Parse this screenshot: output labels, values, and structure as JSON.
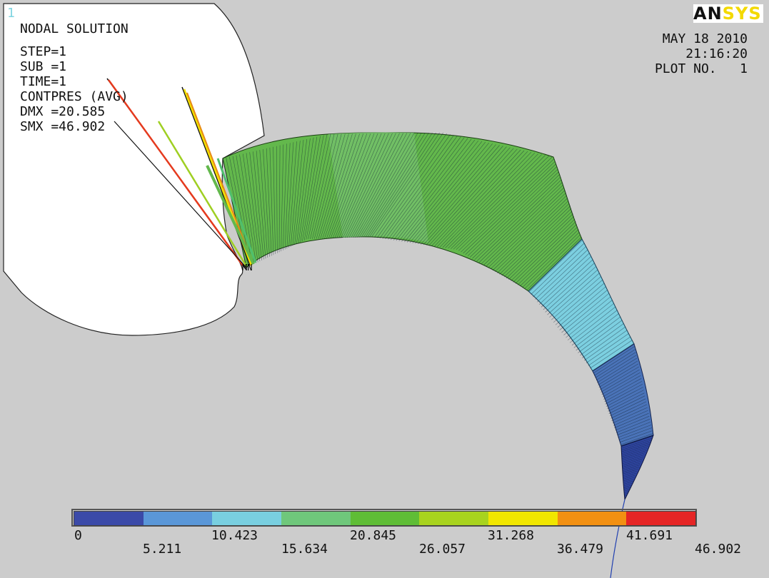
{
  "window_number": "1",
  "info": {
    "title": "NODAL SOLUTION",
    "step": "STEP=1",
    "sub": "SUB =1",
    "time": "TIME=1",
    "item": "CONTPRES (AVG)",
    "dmx": "DMX =20.585",
    "smx": "SMX =46.902"
  },
  "stamp": {
    "date": "MAY 18 2010",
    "time": "21:16:20",
    "plot": "PLOT NO.   1"
  },
  "logo": {
    "an": "AN",
    "sys": "SYS"
  },
  "legend": {
    "colors": [
      "#3b4aa8",
      "#5a97d8",
      "#79cfe0",
      "#6fc77b",
      "#5fbd36",
      "#a8d31e",
      "#f1e600",
      "#f29012",
      "#e52525"
    ],
    "labels_top": [
      "0",
      "10.423",
      "20.845",
      "31.268",
      "41.691"
    ],
    "labels_bottom": [
      "5.211",
      "15.634",
      "26.057",
      "36.479",
      "46.902"
    ]
  },
  "colors": {
    "background": "#cccccc",
    "body_fill": "#ffffff",
    "green": "#63b84c",
    "light_green": "#74c06b",
    "cyan": "#7ccfe0",
    "blue": "#4a73b8",
    "dark_blue": "#2f45a3"
  }
}
